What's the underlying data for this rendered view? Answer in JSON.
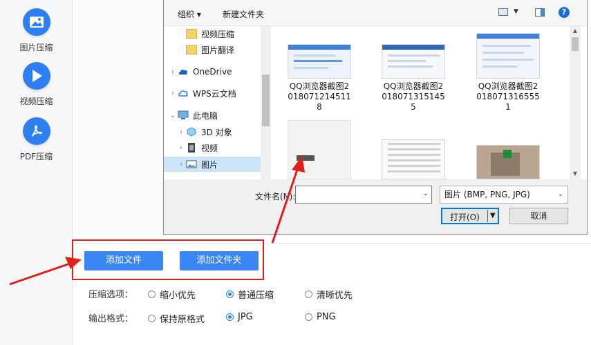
{
  "app": {
    "sidebar": [
      {
        "label": "图片压缩",
        "icon": "image-icon"
      },
      {
        "label": "视频压缩",
        "icon": "play-icon"
      },
      {
        "label": "PDF压缩",
        "icon": "pdf-icon"
      }
    ],
    "add_file_label": "添加文件",
    "add_folder_label": "添加文件夹",
    "compress_options": {
      "label": "压缩选项：",
      "options": [
        "缩小优先",
        "普通压缩",
        "清晰优先"
      ],
      "selected": "普通压缩"
    },
    "output_format": {
      "label": "输出格式：",
      "options": [
        "保持原格式",
        "JPG",
        "PNG"
      ],
      "selected": "JPG"
    }
  },
  "dialog": {
    "toolbar": {
      "organize_label": "组织 ▾",
      "new_folder_label": "新建文件夹"
    },
    "nav_items": [
      {
        "label": "视频压缩",
        "icon": "folder-icon"
      },
      {
        "label": "图片翻译",
        "icon": "folder-icon"
      },
      {
        "label": "OneDrive",
        "icon": "cloud-icon"
      },
      {
        "label": "WPS云文档",
        "icon": "cloud-outline-icon"
      },
      {
        "label": "此电脑",
        "icon": "computer-icon"
      },
      {
        "label": "3D 对象",
        "icon": "cube-icon"
      },
      {
        "label": "视频",
        "icon": "film-icon"
      },
      {
        "label": "图片",
        "icon": "picture-icon"
      }
    ],
    "files": [
      {
        "name": "QQ浏览器截图20180712145118"
      },
      {
        "name": "QQ浏览器截图20180713151455"
      },
      {
        "name": "QQ浏览器截图20180713165551"
      }
    ],
    "filename_label": "文件名(N):",
    "filename_value": "",
    "filter_value": "图片 (BMP, PNG, JPG)",
    "open_label": "打开(O)",
    "cancel_label": "取消"
  },
  "colors": {
    "accent": "#3a86f5",
    "annotation": "#e0201b"
  }
}
